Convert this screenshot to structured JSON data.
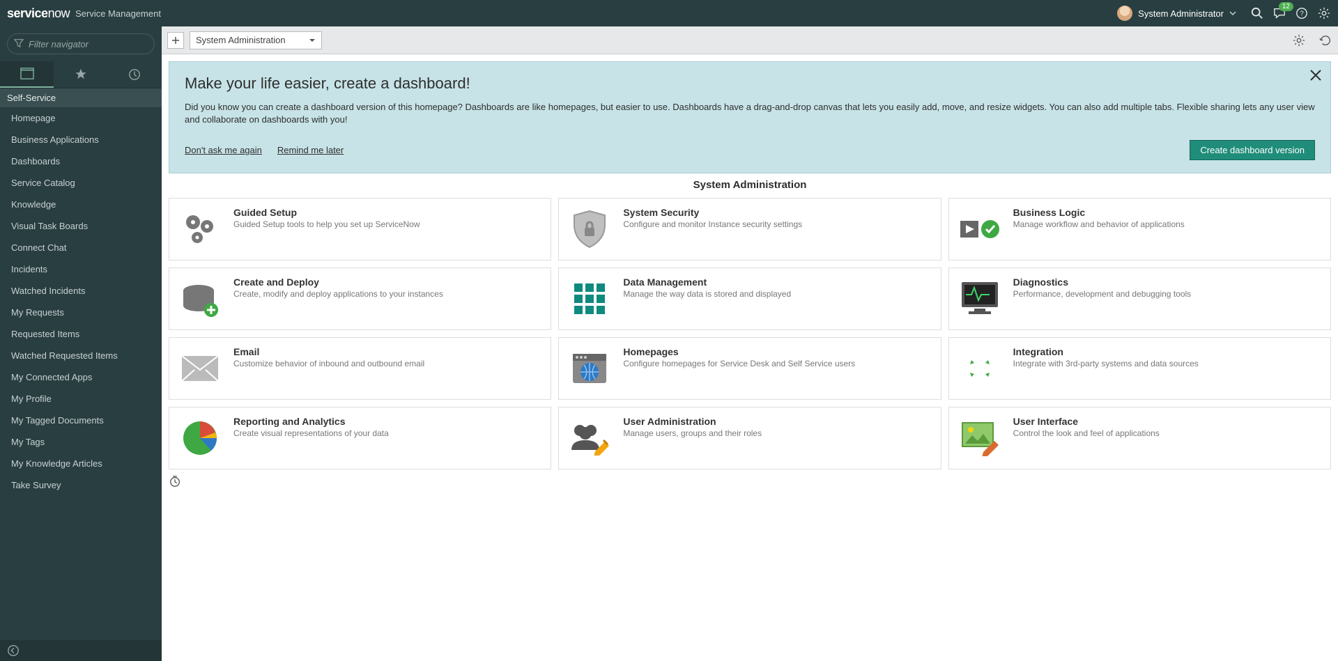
{
  "topbar": {
    "logo_main": "service",
    "logo_sub": "now",
    "product": "Service Management",
    "user_name": "System Administrator",
    "chat_badge": "12"
  },
  "sidebar": {
    "filter_placeholder": "Filter navigator",
    "section_title": "Self-Service",
    "items": [
      "Homepage",
      "Business Applications",
      "Dashboards",
      "Service Catalog",
      "Knowledge",
      "Visual Task Boards",
      "Connect Chat",
      "Incidents",
      "Watched Incidents",
      "My Requests",
      "Requested Items",
      "Watched Requested Items",
      "My Connected Apps",
      "My Profile",
      "My Tagged Documents",
      "My Tags",
      "My Knowledge Articles",
      "Take Survey"
    ]
  },
  "toolbar": {
    "dropdown_value": "System Administration"
  },
  "banner": {
    "title": "Make your life easier, create a dashboard!",
    "body": "Did you know you can create a dashboard version of this homepage? Dashboards are like homepages, but easier to use. Dashboards have a drag-and-drop canvas that lets you easily add, move, and resize widgets. You can also add multiple tabs. Flexible sharing lets any user view and collaborate on dashboards with you!",
    "dont_ask": "Don't ask me again",
    "remind": "Remind me later",
    "create": "Create dashboard version"
  },
  "page": {
    "title": "System Administration"
  },
  "cards": [
    {
      "title": "Guided Setup",
      "desc": "Guided Setup tools to help you set up ServiceNow"
    },
    {
      "title": "System Security",
      "desc": "Configure and monitor Instance security settings"
    },
    {
      "title": "Business Logic",
      "desc": "Manage workflow and behavior of applications"
    },
    {
      "title": "Create and Deploy",
      "desc": "Create, modify and deploy applications to your instances"
    },
    {
      "title": "Data Management",
      "desc": "Manage the way data is stored and displayed"
    },
    {
      "title": "Diagnostics",
      "desc": "Performance, development and debugging tools"
    },
    {
      "title": "Email",
      "desc": "Customize behavior of inbound and outbound email"
    },
    {
      "title": "Homepages",
      "desc": "Configure homepages for Service Desk and Self Service users"
    },
    {
      "title": "Integration",
      "desc": "Integrate with 3rd-party systems and data sources"
    },
    {
      "title": "Reporting and Analytics",
      "desc": "Create visual representations of your data"
    },
    {
      "title": "User Administration",
      "desc": "Manage users, groups and their roles"
    },
    {
      "title": "User Interface",
      "desc": "Control the look and feel of applications"
    }
  ]
}
